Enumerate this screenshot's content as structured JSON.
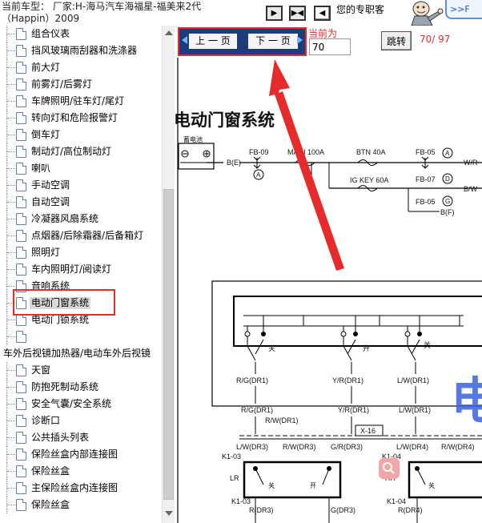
{
  "header": {
    "car_title_line1": "当前车型： 厂家:H-海马汽车海福星-福美来2代",
    "car_title_line2": "（Happin）2009",
    "slogan": "您的专职客",
    "corner_link": ">>F"
  },
  "sidebar": {
    "items": [
      {
        "label": "组合仪表"
      },
      {
        "label": "挡风玻璃雨刮器和洗涤器"
      },
      {
        "label": "前大灯"
      },
      {
        "label": "前雾灯/后雾灯"
      },
      {
        "label": "车牌照明/驻车灯/尾灯"
      },
      {
        "label": "转向灯和危险报警灯"
      },
      {
        "label": "倒车灯"
      },
      {
        "label": "制动灯/高位制动灯"
      },
      {
        "label": "喇叭"
      },
      {
        "label": "手动空调"
      },
      {
        "label": "自动空调"
      },
      {
        "label": "冷凝器风扇系统"
      },
      {
        "label": "点烟器/后除霜器/后备箱灯"
      },
      {
        "label": "照明灯"
      },
      {
        "label": "车内照明灯/阅读灯"
      },
      {
        "label": "音响系统"
      },
      {
        "label": "电动门窗系统",
        "selected": true
      },
      {
        "label": "电动门锁系统"
      },
      {
        "label": ""
      },
      {
        "label": "车外后视镜加热器/电动车外后视镜",
        "wide": true
      },
      {
        "label": "天窗"
      },
      {
        "label": "防抱死制动系统"
      },
      {
        "label": "安全气囊/安全系统"
      },
      {
        "label": "诊断口"
      },
      {
        "label": "公共插头列表"
      },
      {
        "label": "保险丝盒内部连接图"
      },
      {
        "label": "保险丝盒"
      },
      {
        "label": "主保险丝盒内连接图"
      },
      {
        "label": "保险丝盒"
      }
    ]
  },
  "toolbar": {
    "prev_label": "上 一 页",
    "next_label": "下 一 页",
    "current_label": "当前为",
    "current_page_value": "70",
    "jump_label": "跳转",
    "page_counter": "70/ 97"
  },
  "diagram": {
    "title": "电动门窗系统",
    "battery_label": "蓄电池",
    "labels": {
      "fb09": "FB-09",
      "main100a": "MAIN 100A",
      "btn40a": "BTN 40A",
      "fb05a": "FB-05",
      "wr": "W/R",
      "be": "B(E)",
      "igkey60a": "IG KEY 60A",
      "fb07": "FB-07",
      "bw": "B/W",
      "fb05b": "FB-05",
      "bf": "B(F)",
      "sw_off": "关",
      "sw_on": "开",
      "rg_dr1": "R/G(DR1)",
      "yr_dr1": "Y/R(DR1)",
      "lw_dr1": "L/W(DR1)",
      "rg_dr1b": "R/G(DR1)",
      "yr_dr1b": "Y/R(DR1)",
      "lw_dr1b": "L/W(DR1)",
      "rw_dr1": "R/W(DR1)",
      "x16": "X-16",
      "lw_dr3": "L/W(DR3)",
      "rw_dr3": "R/W(DR3)",
      "gr_dr3": "G/R(DR3)",
      "lw_dr4": "L/W(DR4)",
      "rw_dr4": "R/W(DR4)",
      "k103a": "K1-03",
      "k104a": "K1-04",
      "lr": "LR",
      "rr": "RR",
      "k103b": "K1-03",
      "k104b": "K1-04",
      "r_dr3": "R(DR3)",
      "g_dr3": "G(DR3)",
      "r_dr4": "R(DR4)"
    },
    "circle_a": "A",
    "circle_d": "D",
    "circle_g": "G",
    "watermark": "电"
  },
  "colors": {
    "highlight_red": "#e52b2b",
    "pager_blue": "#1e3b7a",
    "watermark_blue": "#3b63d9",
    "page_counter_red": "#e52b2b"
  }
}
